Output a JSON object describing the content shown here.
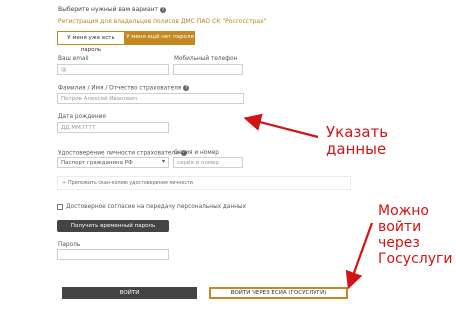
{
  "header": {
    "choose_text": "Выберите нужный вам вариант",
    "registration_text": "Регистрация для владельцев полисов ДМС ПАО СК \"Росгосстрах\""
  },
  "toggle": {
    "have_password": "У меня уже есть пароль",
    "no_password": "У меня ещё нет пароля"
  },
  "fields": {
    "email_label": "Ваш email",
    "email_placeholder": "@",
    "phone_label": "Мобильный телефон",
    "fio_label": "Фамилия / Имя / Отчество страхователя",
    "fio_placeholder": "Петров Алексей Иванович",
    "dob_label": "Дата рождения",
    "dob_placeholder": "ДД.ММ.ГГГГ",
    "id_label": "Удостоверение личности страхователя",
    "id_value": "Паспорт гражданина РФ",
    "series_label": "Серия и номер",
    "series_placeholder": "серия и номер",
    "attach_scan": "Приложить скан-копию удостоверения личности",
    "consent": "Достоверное согласие на передачу персональных данных",
    "password_label": "Пароль"
  },
  "buttons": {
    "get_temp_password": "Получить временный пароль",
    "login": "ВОЙТИ",
    "login_esia": "ВОЙТИ ЧЕРЕЗ ЕСИА (ГОСУСЛУГИ)"
  },
  "annotations": {
    "enter_data": [
      "Указать",
      "данные"
    ],
    "can_login": [
      "Можно",
      "войти",
      "через",
      "Госуслуги"
    ]
  },
  "colors": {
    "accent": "#c38a21",
    "annotation": "#d21414",
    "dark_button": "#444444"
  }
}
